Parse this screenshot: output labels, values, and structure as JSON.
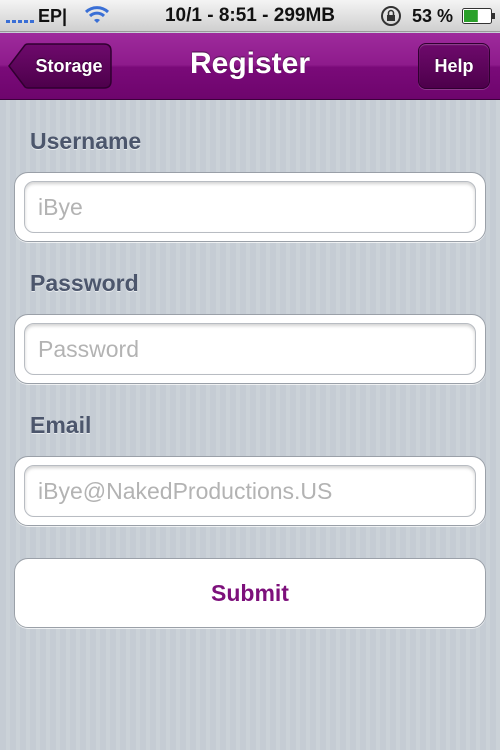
{
  "status_bar": {
    "carrier": "EP|",
    "center_text": "10/1 - 8:51 - 299MB",
    "battery_percent": "53 %",
    "battery_level": 0.53,
    "icons": [
      "signal-icon",
      "wifi-icon",
      "orientation-lock-icon",
      "battery-icon"
    ]
  },
  "nav_bar": {
    "title": "Register",
    "back_label": "Storage",
    "help_label": "Help",
    "color": "#8e1b8c"
  },
  "form": {
    "username": {
      "label": "Username",
      "placeholder": "iBye",
      "value": ""
    },
    "password": {
      "label": "Password",
      "placeholder": "Password",
      "value": ""
    },
    "email": {
      "label": "Email",
      "placeholder": "iBye@NakedProductions.US",
      "value": ""
    },
    "submit_label": "Submit"
  },
  "colors": {
    "accent": "#7d107b",
    "label_text": "#4c566c",
    "background": "#c5ccd4"
  }
}
